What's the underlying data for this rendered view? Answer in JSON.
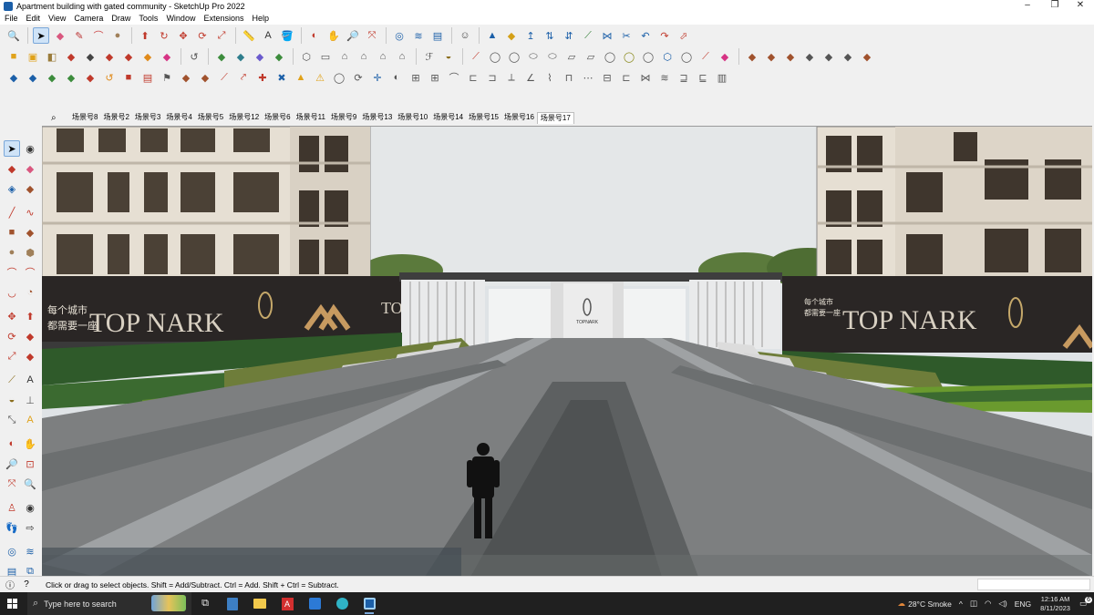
{
  "window": {
    "title": "Apartment building with gated community - SketchUp Pro 2022"
  },
  "window_controls": [
    "–",
    "❐",
    "✕"
  ],
  "menu": [
    "File",
    "Edit",
    "View",
    "Camera",
    "Draw",
    "Tools",
    "Window",
    "Extensions",
    "Help"
  ],
  "scene_tabs": [
    "场景号8",
    "场景号2",
    "场景号3",
    "场景号4",
    "场景号5",
    "场景号12",
    "场景号6",
    "场景号11",
    "场景号9",
    "场景号13",
    "场景号10",
    "场景号14",
    "场景号15",
    "场景号16",
    "场景号17"
  ],
  "active_scene": "场景号17",
  "viewport": {
    "billboard_left": {
      "brand": "TOP NARK",
      "tagline_1": "每个城市",
      "tagline_2": "都需要一座",
      "brand_short": "TOP"
    },
    "billboard_right": {
      "brand": "TOP NARK",
      "tagline_1": "每个城市",
      "tagline_2": "都需要一座"
    },
    "gate_sign": "TOPNARK"
  },
  "status": {
    "message": "Click or drag to select objects. Shift = Add/Subtract. Ctrl = Add. Shift + Ctrl = Subtract."
  },
  "taskbar": {
    "search_placeholder": "Type here to search",
    "weather": "28°C  Smoke",
    "language": "ENG",
    "time": "12:16 AM",
    "date": "8/11/2023",
    "notification_count": "6"
  },
  "colors": {
    "accent": "#1b5fa8",
    "taskbar": "#202020",
    "sky": "#e4e7e8",
    "grass": "#5f8a2e"
  }
}
